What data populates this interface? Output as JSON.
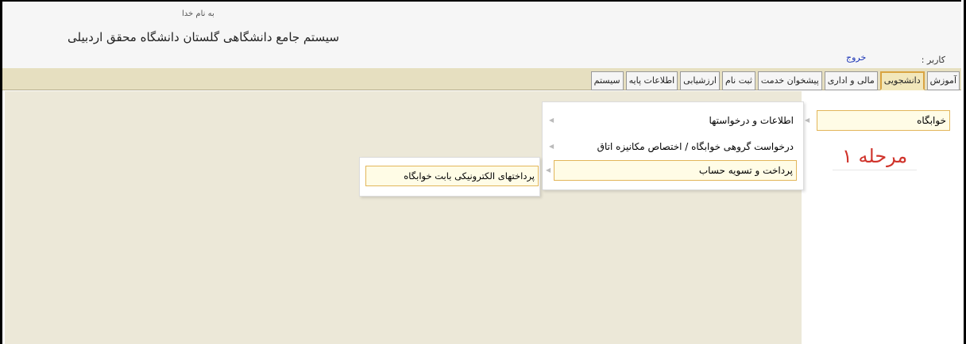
{
  "header": {
    "bismillah": "به نام خدا",
    "system_title": "سیستم جامع دانشگاهی گلستان    دانشگاه محقق اردبیلی",
    "user_label": "کاربر :",
    "logout_label": "خروج"
  },
  "tabs": [
    {
      "label": "آموزش",
      "active": false
    },
    {
      "label": "دانشجویی",
      "active": true
    },
    {
      "label": "مالی و اداری",
      "active": false
    },
    {
      "label": "پیشخوان خدمت",
      "active": false
    },
    {
      "label": "ثبت نام",
      "active": false
    },
    {
      "label": "ارزشیابی",
      "active": false
    },
    {
      "label": "اطلاعات پایه",
      "active": false
    },
    {
      "label": "سیستم",
      "active": false
    }
  ],
  "menu": {
    "level1_item": "خوابگاه",
    "submenu_items": [
      "اطلاعات و درخواستها",
      "درخواست گروهی خوابگاه / اختصاص مکانیزه اتاق",
      "پرداخت و تسویه حساب"
    ],
    "level3_item": "پرداختهای الکترونیکی بابت خوابگاه"
  },
  "annotation": {
    "step_label": "مرحله ۱"
  },
  "colors": {
    "tabbar": "#e6dfc0",
    "content_bg": "#ece8d8",
    "highlight_border": "#e2b65a",
    "highlight_bg": "#fffce6",
    "step_color": "#d0342c",
    "link_color": "#1a33b5"
  }
}
